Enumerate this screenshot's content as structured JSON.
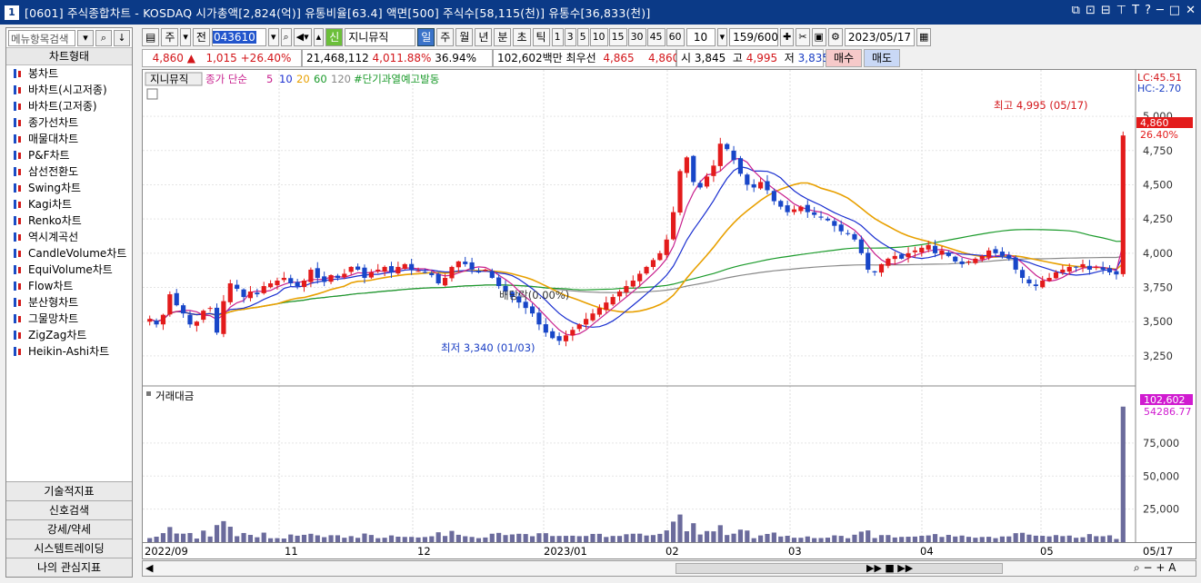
{
  "window": {
    "number": "1",
    "title": "[0601] 주식종합차트 - KOSDAQ 시가총액[2,824(억)] 유통비율[63.4] 액면[500] 주식수[58,115(천)] 유통수[36,833(천)]"
  },
  "sidebar": {
    "search_placeholder": "메뉴항목검색",
    "section_title": "차트형태",
    "items": [
      "봉차트",
      "바차트(시고저종)",
      "바차트(고저종)",
      "종가선차트",
      "매물대차트",
      "P&F차트",
      "삼선전환도",
      "Swing차트",
      "Kagi차트",
      "Renko차트",
      "역시계곡선",
      "CandleVolume차트",
      "EquiVolume차트",
      "Flow차트",
      "분산형차트",
      "그물망차트",
      "ZigZag차트",
      "Heikin-Ashi차트"
    ],
    "bottom_tabs": [
      "기술적지표",
      "신호검색",
      "강세/약세",
      "시스템트레이딩",
      "나의 관심지표"
    ]
  },
  "toolbar": {
    "period_type": "주",
    "market": "전",
    "code": "043610",
    "shin": "신",
    "stock_name": "지니뮤직",
    "periods": [
      "일",
      "주",
      "월",
      "년",
      "분",
      "초",
      "틱"
    ],
    "active_period": "일",
    "intervals": [
      "1",
      "3",
      "5",
      "10",
      "15",
      "30",
      "45",
      "60"
    ],
    "interval_value": "10",
    "count": "159",
    "count_total": "/600",
    "date": "2023/05/17"
  },
  "quote": {
    "price": "4,860",
    "change_arrow": "▲",
    "change": "1,015",
    "change_pct": "+26.40%",
    "volume": "21,468,112",
    "volume_ratio": "4,011.88%",
    "turnover": "36.94%",
    "amount": "102,602백만",
    "pref_label": "최우선",
    "best_ask": "4,865",
    "best_bid": "4,860",
    "open_label": "시",
    "open": "3,845",
    "high_label": "고",
    "high": "4,995",
    "low_label": "저",
    "low": "3,835",
    "buy_button": "매수",
    "sell_button": "매도"
  },
  "price_pane": {
    "legend_name": "지니뮤직",
    "legend_ma_label": "종가 단순",
    "legend_mas": [
      "5",
      "10",
      "20",
      "60",
      "120"
    ],
    "legend_signal": "#단기과열예고발동",
    "lc_label": "LC:45.51",
    "hc_label": "HC:-2.70",
    "high_note": "최고 4,995 (05/17)",
    "low_note": "최저 3,340 (01/03)",
    "event_note": "배당락(0.00%)",
    "current_price_tag": "4,860",
    "current_pct_tag": "26.40%",
    "y_ticks": [
      "5,000",
      "4,750",
      "4,500",
      "4,250",
      "4,000",
      "3,750",
      "3,500",
      "3,250"
    ]
  },
  "volume_pane": {
    "legend": "거래대금",
    "current_tag": "102,602",
    "ma_tag": "54286.77",
    "y_ticks": [
      "75,000",
      "50,000",
      "25,000"
    ]
  },
  "x_axis": [
    "2022/09",
    "11",
    "12",
    "2023/01",
    "02",
    "03",
    "04",
    "05",
    "05/17"
  ],
  "colors": {
    "up": "#e31b1b",
    "down": "#1846c8",
    "ma5": "#c8208e",
    "ma10": "#1a2fd0",
    "ma20": "#e8a000",
    "ma60": "#1a9a2a",
    "ma120": "#888888",
    "volume": "#6b6b9c"
  },
  "chart_data": {
    "type": "candlestick",
    "y_range": [
      3150,
      5100
    ],
    "volume_range": [
      0,
      110000
    ],
    "series": [
      {
        "name": "지니뮤직",
        "close_path": [
          3520,
          3480,
          3550,
          3700,
          3620,
          3560,
          3480,
          3500,
          3580,
          3600,
          3420,
          3650,
          3780,
          3740,
          3680,
          3720,
          3700,
          3760,
          3780,
          3800,
          3820,
          3780,
          3760,
          3800,
          3880,
          3820,
          3790,
          3840,
          3820,
          3850,
          3900,
          3880,
          3820,
          3860,
          3880,
          3900,
          3860,
          3900,
          3920,
          3880,
          3870,
          3860,
          3840,
          3780,
          3820,
          3900,
          3940,
          3920,
          3880,
          3860,
          3880,
          3820,
          3760,
          3720,
          3680,
          3640,
          3600,
          3560,
          3480,
          3420,
          3380,
          3360,
          3400,
          3440,
          3480,
          3520,
          3560,
          3600,
          3640,
          3680,
          3720,
          3760,
          3800,
          3850,
          3900,
          3950,
          4000,
          4100,
          4300,
          4600,
          4700,
          4520,
          4480,
          4560,
          4640,
          4800,
          4760,
          4680,
          4580,
          4500,
          4480,
          4520,
          4460,
          4380,
          4340,
          4300,
          4320,
          4340,
          4300,
          4280,
          4260,
          4240,
          4200,
          4160,
          4140,
          4100,
          4000,
          3880,
          3860,
          3920,
          3960,
          3980,
          3960,
          4000,
          4020,
          4040,
          4060,
          4000,
          4020,
          3980,
          3940,
          3920,
          3940,
          3960,
          3980,
          4020,
          4000,
          3980,
          3960,
          3880,
          3820,
          3780,
          3760,
          3800,
          3820,
          3860,
          3880,
          3900,
          3900,
          3920,
          3880,
          3900,
          3880,
          3860,
          3845,
          4860
        ]
      }
    ]
  }
}
